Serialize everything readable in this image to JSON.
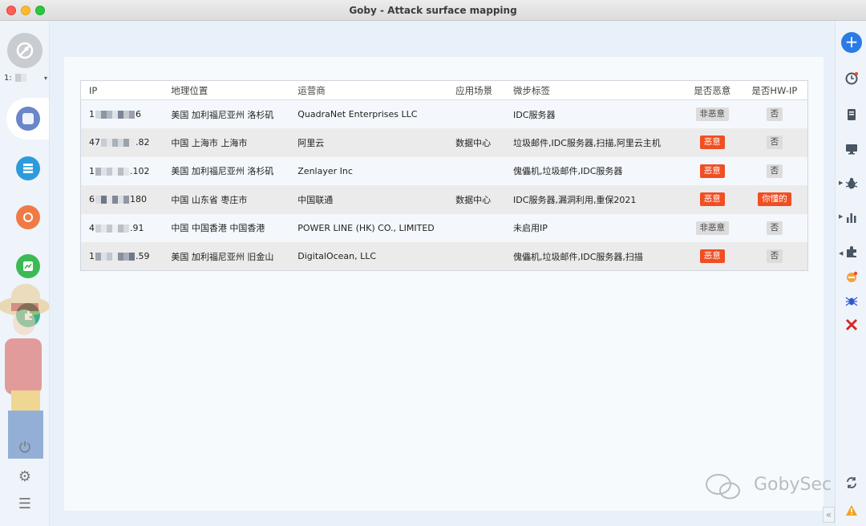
{
  "window": {
    "title": "Goby - Attack surface mapping"
  },
  "sidebar": {
    "workspace_label": "1:",
    "caret": "▾"
  },
  "table": {
    "headers": {
      "ip": "IP",
      "geo": "地理位置",
      "isp": "运营商",
      "app": "应用场景",
      "tags": "微步标签",
      "malicious": "是否恶意",
      "hw": "是否HW-IP"
    },
    "rows": [
      {
        "ip_start": "1",
        "ip_end": "6",
        "geo": "美国 加利福尼亚州 洛杉矶",
        "isp": "QuadraNet Enterprises LLC",
        "app": "",
        "tags": "IDC服务器",
        "malicious": "非恶意",
        "hw": "否"
      },
      {
        "ip_start": "47",
        "ip_end": ".82",
        "geo": "中国 上海市 上海市",
        "isp": "阿里云",
        "app": "数据中心",
        "tags": "垃圾邮件,IDC服务器,扫描,阿里云主机",
        "malicious": "恶意",
        "hw": "否"
      },
      {
        "ip_start": "1",
        "ip_end": ".102",
        "geo": "美国 加利福尼亚州 洛杉矶",
        "isp": "Zenlayer Inc",
        "app": "",
        "tags": "傀儡机,垃圾邮件,IDC服务器",
        "malicious": "恶意",
        "hw": "否"
      },
      {
        "ip_start": "6",
        "ip_end": "180",
        "geo": "中国 山东省 枣庄市",
        "isp": "中国联通",
        "app": "数据中心",
        "tags": "IDC服务器,漏洞利用,重保2021",
        "malicious": "恶意",
        "hw": "你懂的"
      },
      {
        "ip_start": "4",
        "ip_end": ".91",
        "geo": "中国 中国香港 中国香港",
        "isp": "POWER LINE (HK) CO., LIMITED",
        "app": "",
        "tags": "未启用IP",
        "malicious": "非恶意",
        "hw": "否"
      },
      {
        "ip_start": "1",
        "ip_end": ".59",
        "geo": "美国 加利福尼亚州 旧金山",
        "isp": "DigitalOcean, LLC",
        "app": "",
        "tags": "傀儡机,垃圾邮件,IDC服务器,扫描",
        "malicious": "恶意",
        "hw": "否"
      }
    ]
  },
  "watermark": "GobySec",
  "collapse": "«",
  "colors": {
    "accent": "#2c7be5",
    "malicious": "#f04e23",
    "benign": "#dcdcdc"
  }
}
